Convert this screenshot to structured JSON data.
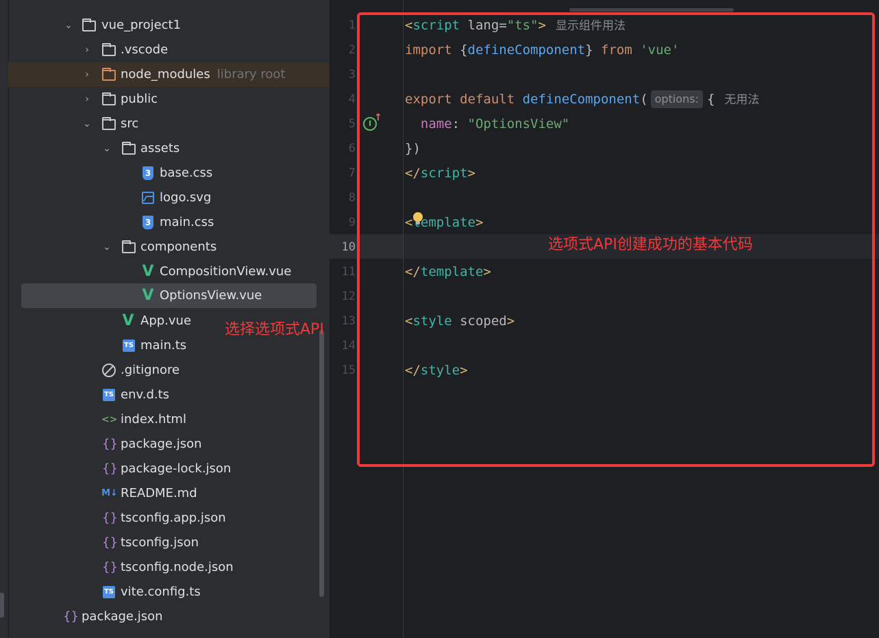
{
  "project_tree": {
    "items": [
      {
        "label": "vue_project1",
        "type": "folder",
        "expanded": true
      },
      {
        "label": ".vscode",
        "type": "folder",
        "expanded": false
      },
      {
        "label": "node_modules",
        "sublabel": "library root",
        "type": "folder",
        "expanded": false
      },
      {
        "label": "public",
        "type": "folder",
        "expanded": false
      },
      {
        "label": "src",
        "type": "folder",
        "expanded": true
      },
      {
        "label": "assets",
        "type": "folder",
        "expanded": true
      },
      {
        "label": "base.css",
        "type": "css"
      },
      {
        "label": "logo.svg",
        "type": "image"
      },
      {
        "label": "main.css",
        "type": "css"
      },
      {
        "label": "components",
        "type": "folder",
        "expanded": true
      },
      {
        "label": "CompositionView.vue",
        "type": "vue"
      },
      {
        "label": "OptionsView.vue",
        "type": "vue",
        "selected": true
      },
      {
        "label": "App.vue",
        "type": "vue"
      },
      {
        "label": "main.ts",
        "type": "ts"
      },
      {
        "label": ".gitignore",
        "type": "ignore"
      },
      {
        "label": "env.d.ts",
        "type": "ts"
      },
      {
        "label": "index.html",
        "type": "html"
      },
      {
        "label": "package.json",
        "type": "json"
      },
      {
        "label": "package-lock.json",
        "type": "json"
      },
      {
        "label": "README.md",
        "type": "markdown"
      },
      {
        "label": "tsconfig.app.json",
        "type": "json"
      },
      {
        "label": "tsconfig.json",
        "type": "json"
      },
      {
        "label": "tsconfig.node.json",
        "type": "json"
      },
      {
        "label": "vite.config.ts",
        "type": "ts"
      },
      {
        "label": "package.json",
        "type": "json"
      }
    ],
    "icon_glyphs": {
      "vue": "V",
      "ts": "TS",
      "css": "3",
      "json": "{}",
      "html": "<>",
      "markdown": "M↓"
    }
  },
  "editor": {
    "line_numbers": [
      "1",
      "2",
      "3",
      "4",
      "5",
      "6",
      "7",
      "8",
      "9",
      "10",
      "11",
      "12",
      "13",
      "14",
      "15"
    ],
    "active_line": "10",
    "lines": {
      "l1_open": "<",
      "l1_tag": "script",
      "l1_attr": " lang=",
      "l1_val": "\"ts\"",
      "l1_close": ">",
      "l1_hint": "显示组件用法",
      "l2_kw": "import",
      "l2_b1": " {",
      "l2_fn": "defineComponent",
      "l2_b2": "} ",
      "l2_from": "from",
      "l2_str": " 'vue'",
      "l4_kw": "export default",
      "l4_fn": " defineComponent",
      "l4_paren": "(",
      "l4_inlay": "options:",
      "l4_brace": "{",
      "l4_hint": "无用法",
      "l5_prop": "  name",
      "l5_colon": ": ",
      "l5_str": "\"OptionsView\"",
      "l6": "})",
      "l7_open": "</",
      "l7_tag": "script",
      "l7_close": ">",
      "l9_open": "<",
      "l9_tag": "template",
      "l9_close": ">",
      "l11_open": "</",
      "l11_tag": "template",
      "l11_close": ">",
      "l13_open": "<",
      "l13_tag": "style",
      "l13_attr": " scoped",
      "l13_close": ">",
      "l15_open": "</",
      "l15_tag": "style",
      "l15_close": ">"
    }
  },
  "annotations": {
    "editor_note": "选项式API创建成功的基本代码",
    "tree_note": "选择选项式API",
    "color": "#ed3b3b"
  },
  "colors": {
    "tree_bg": "#2b2d30",
    "editor_bg": "#1e1f22",
    "selection_bg": "#43454a",
    "library_row_bg": "#3a3128",
    "vue_green": "#3fba83",
    "ts_blue": "#4d8fe6"
  }
}
